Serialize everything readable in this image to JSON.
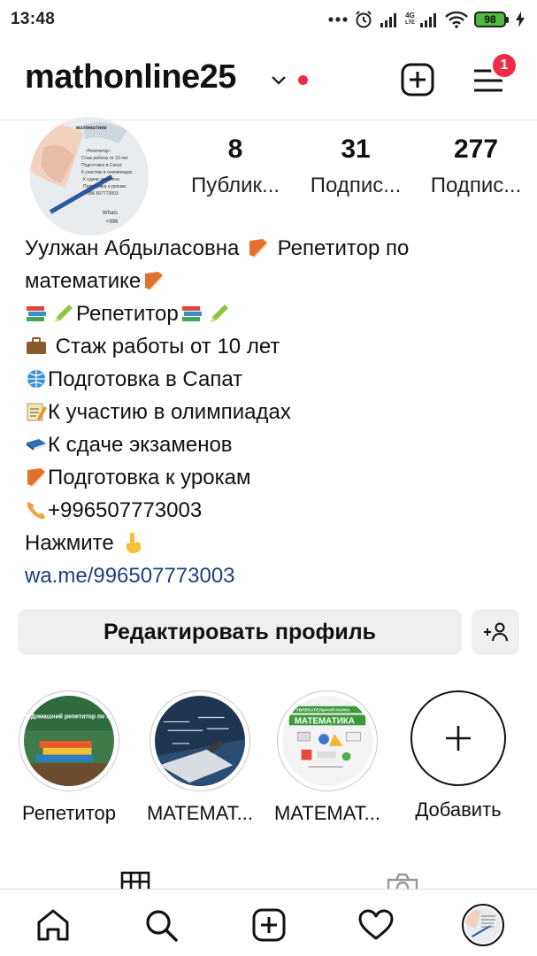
{
  "status_bar": {
    "time": "13:48",
    "network_label_top": "4G",
    "network_label_bottom": "LTE",
    "battery": "98"
  },
  "header": {
    "username": "mathonline25",
    "notification_count": "1"
  },
  "avatar_image_text": {
    "line1": "математике",
    "line2": "~Репетитор~",
    "line3": "Стаж работы от 10 лет",
    "line4": "Подготовка в Сапат",
    "line5": "К участию в олимпиадах",
    "line6": "К сдаче экзамена",
    "line7": "Подготовка к урокам",
    "line8": "+996 507773003",
    "line9": "Whats",
    "line10": "+996"
  },
  "stats": [
    {
      "value": "8",
      "label": "Публик..."
    },
    {
      "value": "31",
      "label": "Подпис..."
    },
    {
      "value": "277",
      "label": "Подпис..."
    }
  ],
  "bio": {
    "name_line_a": "Уулжан Абдыласовна",
    "name_line_b": "Репетитор по",
    "name_line_c": "математике",
    "line_tutor": "Репетитор",
    "line_experience": "Стаж работы от 10 лет",
    "line_sapat": "Подготовка в Сапат",
    "line_olympiad": "К участию в олимпиадах",
    "line_exams": "К сдаче экзаменов",
    "line_lessons": "Подготовка к урокам",
    "line_phone": "+996507773003",
    "line_press": "Нажмите",
    "link": "wa.me/996507773003"
  },
  "buttons": {
    "edit_profile": "Редактировать профиль"
  },
  "highlights": [
    {
      "label": "Репетитор",
      "image_title": "Домашний репетитор по Математике"
    },
    {
      "label": "МАТЕМАТ..."
    },
    {
      "label": "МАТЕМАТ...",
      "image_top": "УВЛЕКАТЕЛЬНАЯ НАУКА",
      "image_title": "МАТЕМАТИКА"
    },
    {
      "label": "Добавить"
    }
  ],
  "colors": {
    "accent_red": "#ed2c47",
    "link_blue": "#1f3f7a",
    "button_bg": "#efefef"
  },
  "icons": {
    "status": [
      "dots-icon",
      "alarm-icon",
      "signal-icon",
      "wifi-icon",
      "battery-icon",
      "charging-icon"
    ],
    "header": [
      "chevron-down-icon",
      "new-post-icon",
      "menu-icon"
    ],
    "nav": [
      "home-icon",
      "search-icon",
      "add-icon",
      "heart-icon",
      "profile-avatar"
    ]
  }
}
